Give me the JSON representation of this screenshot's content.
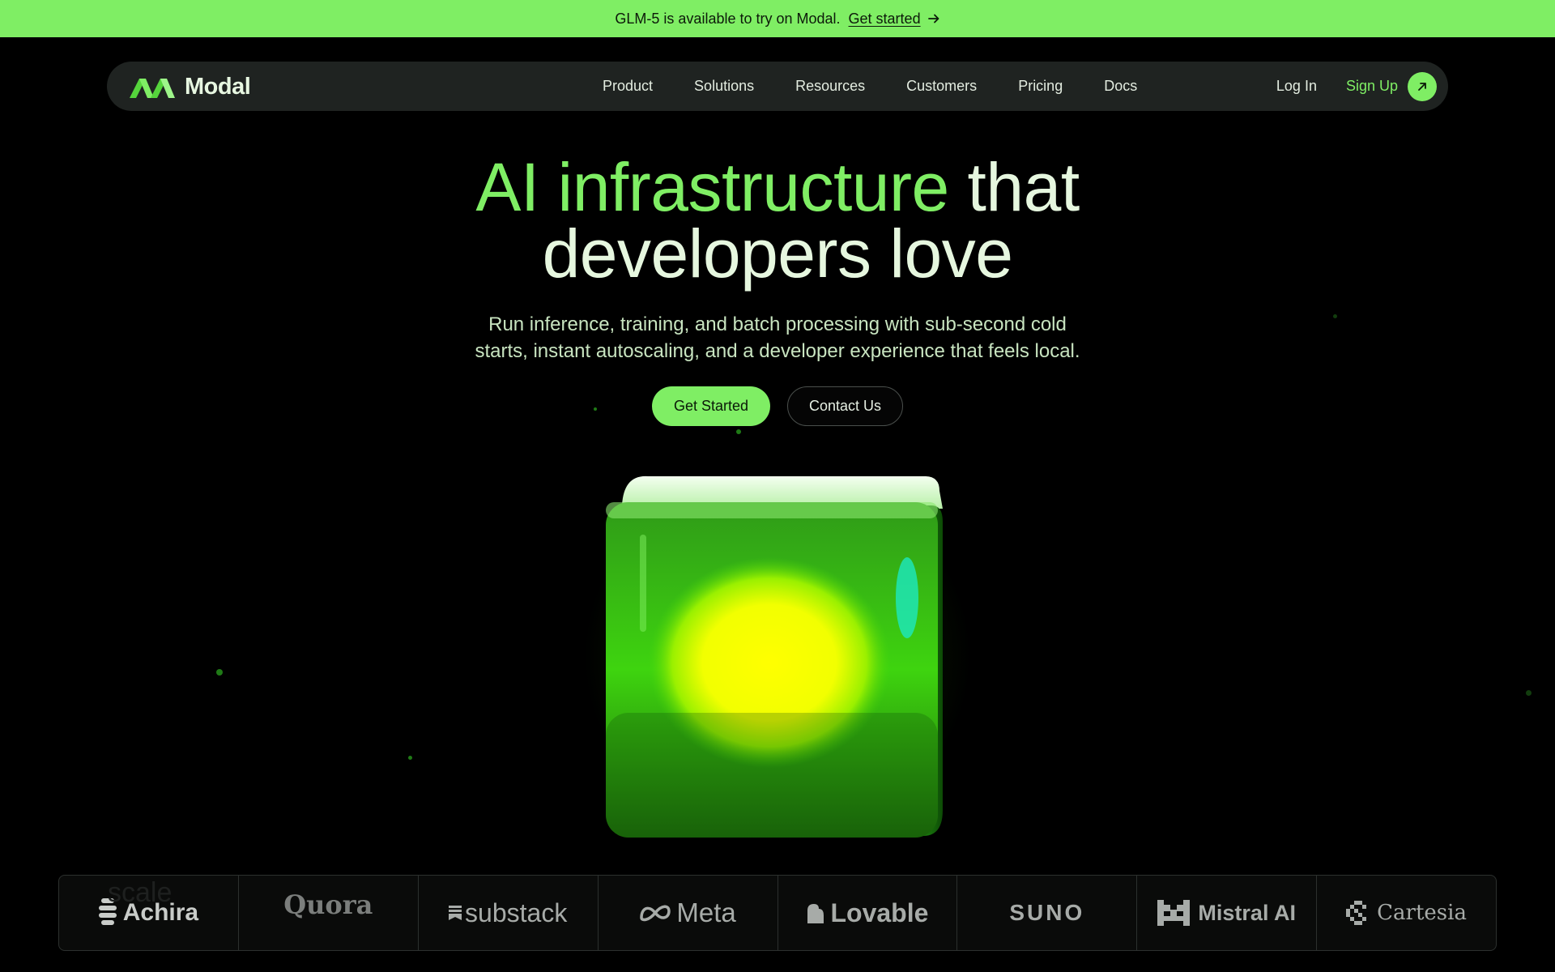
{
  "announcement": {
    "text": "GLM-5 is available to try on Modal.",
    "link_label": "Get started"
  },
  "nav": {
    "brand": "Modal",
    "links": [
      "Product",
      "Solutions",
      "Resources",
      "Customers",
      "Pricing",
      "Docs"
    ],
    "login": "Log In",
    "signup": "Sign Up"
  },
  "hero": {
    "title_accent": "AI infrastructure",
    "title_rest_line1": " that",
    "title_line2": "developers love",
    "subtitle_line1": "Run inference, training, and batch processing with sub-second cold",
    "subtitle_line2": "starts, instant autoscaling, and a developer experience that feels local.",
    "primary_cta": "Get Started",
    "secondary_cta": "Contact Us"
  },
  "logos": {
    "items": [
      "Achira",
      "Quora",
      "substack",
      "Meta",
      "Lovable",
      "SUNO",
      "Mistral AI",
      "Cartesia"
    ],
    "ghost_text": "scale"
  },
  "colors": {
    "accent": "#7fee64",
    "background": "#000000",
    "nav_bg": "#1f2321",
    "text": "#e6f7df"
  }
}
